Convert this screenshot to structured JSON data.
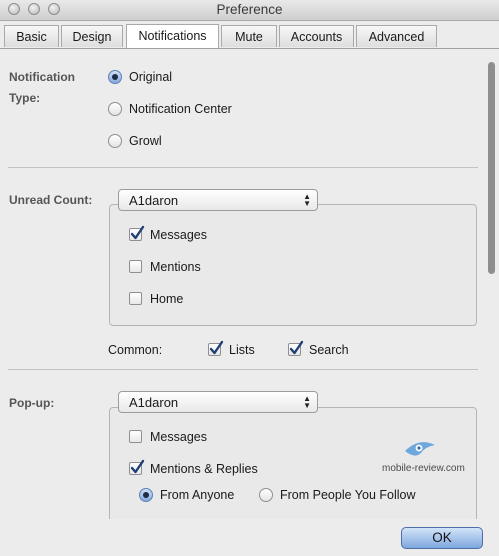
{
  "window": {
    "title": "Preference"
  },
  "tabs": [
    "Basic",
    "Design",
    "Notifications",
    "Mute",
    "Accounts",
    "Advanced"
  ],
  "notification": {
    "label_line1": "Notification",
    "label_line2": "Type:",
    "options": [
      "Original",
      "Notification Center",
      "Growl"
    ],
    "selected": "Original"
  },
  "unread": {
    "label": "Unread Count:",
    "account": "A1daron",
    "items": [
      {
        "label": "Messages",
        "checked": true
      },
      {
        "label": "Mentions",
        "checked": false
      },
      {
        "label": "Home",
        "checked": false
      }
    ],
    "common_label": "Common:",
    "common": [
      {
        "label": "Lists",
        "checked": true
      },
      {
        "label": "Search",
        "checked": true
      }
    ]
  },
  "popup": {
    "label": "Pop-up:",
    "account": "A1daron",
    "items": [
      {
        "label": "Messages",
        "checked": false
      },
      {
        "label": "Mentions & Replies",
        "checked": true
      }
    ],
    "from_options": [
      "From Anyone",
      "From People You Follow"
    ],
    "from_selected": "From Anyone"
  },
  "watermark": "mobile-review.com",
  "ok_label": "OK",
  "colors": {
    "accent": "#86a9dc",
    "ok_button": "#7ea7de"
  }
}
